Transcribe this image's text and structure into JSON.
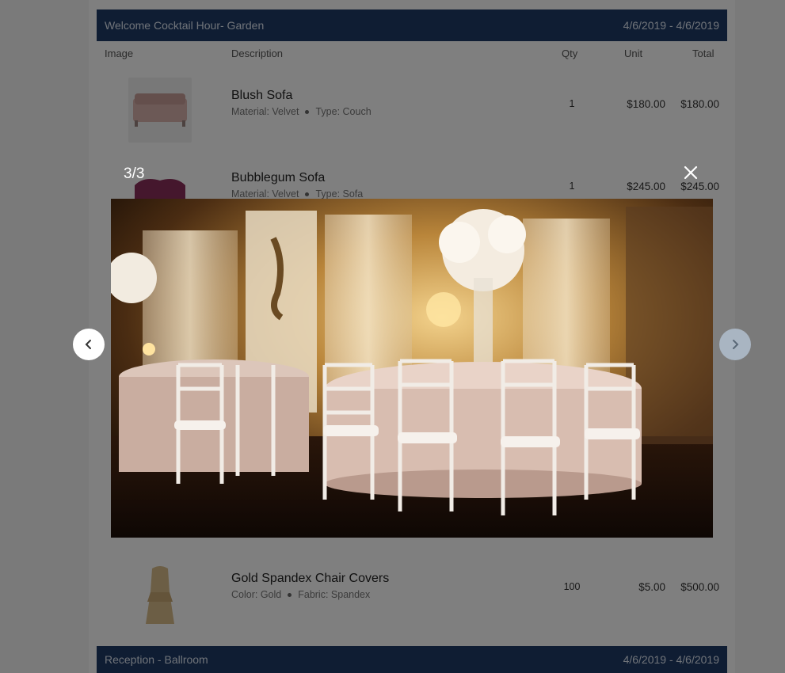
{
  "sections": [
    {
      "title": "Welcome Cocktail Hour- Garden",
      "dates": "4/6/2019 - 4/6/2019"
    },
    {
      "title": "Reception - Ballroom",
      "dates": "4/6/2019 - 4/6/2019"
    }
  ],
  "columns": {
    "image": "Image",
    "description": "Description",
    "qty": "Qty",
    "unit": "Unit",
    "total": "Total"
  },
  "rows": [
    {
      "name": "Blush Sofa",
      "meta_a": "Material: Velvet",
      "meta_b": "Type: Couch",
      "qty": "1",
      "unit": "$180.00",
      "total": "$180.00"
    },
    {
      "name": "Bubblegum Sofa",
      "meta_a": "Material: Velvet",
      "meta_b": "Type: Sofa",
      "qty": "1",
      "unit": "$245.00",
      "total": "$245.00"
    },
    {
      "name": "Gold Spandex Chair Covers",
      "meta_a": "Color: Gold",
      "meta_b": "Fabric: Spandex",
      "qty": "100",
      "unit": "$5.00",
      "total": "$500.00"
    }
  ],
  "lightbox": {
    "counter": "3/3"
  },
  "colors": {
    "section_header": "#1f3b66",
    "overlay": "rgba(0,0,0,0.5)"
  }
}
